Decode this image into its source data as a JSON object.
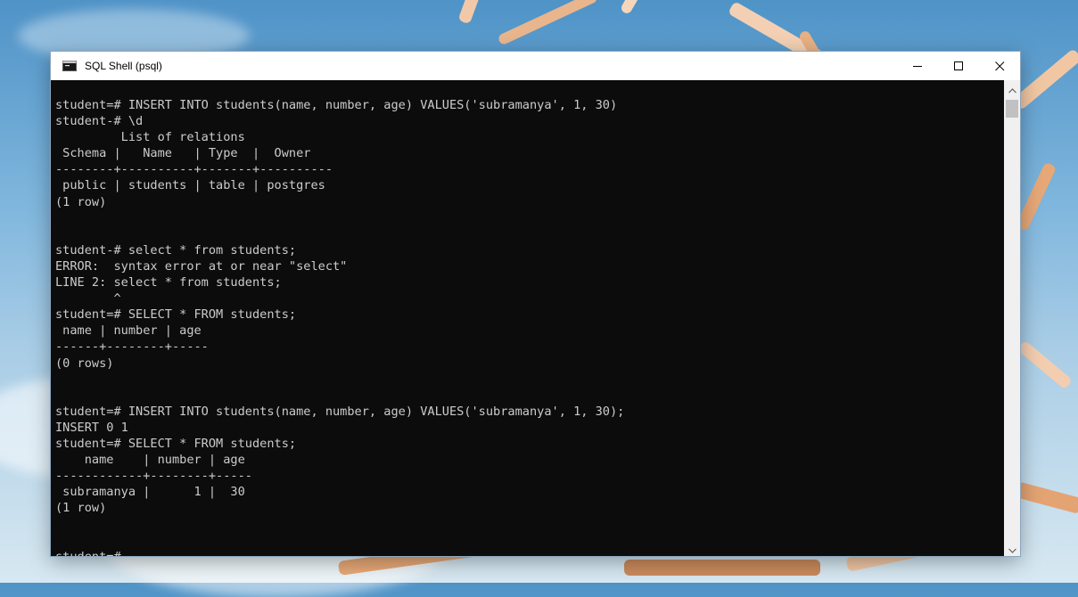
{
  "window": {
    "title": "SQL Shell (psql)"
  },
  "terminal": {
    "lines": [
      "student=# INSERT INTO students(name, number, age) VALUES('subramanya', 1, 30)",
      "student-# \\d",
      "         List of relations",
      " Schema |   Name   | Type  |  Owner",
      "--------+----------+-------+----------",
      " public | students | table | postgres",
      "(1 row)",
      "",
      "",
      "student-# select * from students;",
      "ERROR:  syntax error at or near \"select\"",
      "LINE 2: select * from students;",
      "        ^",
      "student=# SELECT * FROM students;",
      " name | number | age",
      "------+--------+-----",
      "(0 rows)",
      "",
      "",
      "student=# INSERT INTO students(name, number, age) VALUES('subramanya', 1, 30);",
      "INSERT 0 1",
      "student=# SELECT * FROM students;",
      "    name    | number | age",
      "------------+--------+-----",
      " subramanya |      1 |  30",
      "(1 row)",
      "",
      "",
      "student=# "
    ]
  },
  "icons": {
    "app": "terminal-window-icon",
    "minimize": "minimize-icon",
    "maximize": "maximize-icon",
    "close": "close-icon",
    "scroll_up": "chevron-up-icon",
    "scroll_down": "chevron-down-icon"
  },
  "colors": {
    "terminal_bg": "#0c0c0c",
    "terminal_fg": "#cccccc",
    "titlebar_bg": "#ffffff"
  }
}
